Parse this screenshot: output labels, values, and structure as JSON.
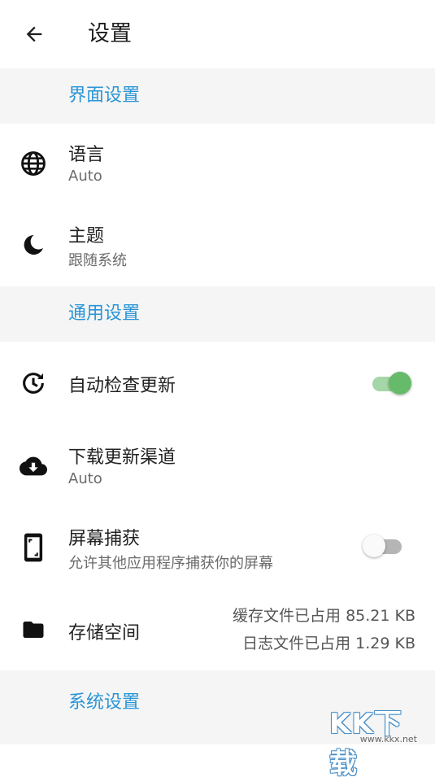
{
  "header": {
    "title": "设置",
    "back_icon": "arrow-left-icon"
  },
  "sections": {
    "interface": {
      "label": "界面设置"
    },
    "general": {
      "label": "通用设置"
    },
    "system": {
      "label": "系统设置"
    }
  },
  "items": {
    "language": {
      "title": "语言",
      "subtitle": "Auto",
      "icon": "globe-icon"
    },
    "theme": {
      "title": "主题",
      "subtitle": "跟随系统",
      "icon": "moon-icon"
    },
    "auto_update": {
      "title": "自动检查更新",
      "icon": "update-clock-icon",
      "toggle_on": true
    },
    "update_channel": {
      "title": "下载更新渠道",
      "subtitle": "Auto",
      "icon": "cloud-download-icon"
    },
    "screen_capture": {
      "title": "屏幕捕获",
      "subtitle": "允许其他应用程序捕获你的屏幕",
      "icon": "phone-screenshot-icon",
      "toggle_on": false
    },
    "storage": {
      "title": "存储空间",
      "cache_text": "缓存文件已占用 85.21 KB",
      "log_text": "日志文件已占用 1.29 KB",
      "icon": "folder-icon"
    }
  },
  "watermark": {
    "text": "KK下载",
    "url": "www.kkx.net"
  },
  "colors": {
    "accent": "#2a95d6",
    "toggle_on_track": "#a5d6a7",
    "toggle_on_thumb": "#66bb6a",
    "toggle_off_track": "#b5b5b5",
    "toggle_off_thumb": "#fafafa",
    "section_bg": "#f5f5f5"
  }
}
